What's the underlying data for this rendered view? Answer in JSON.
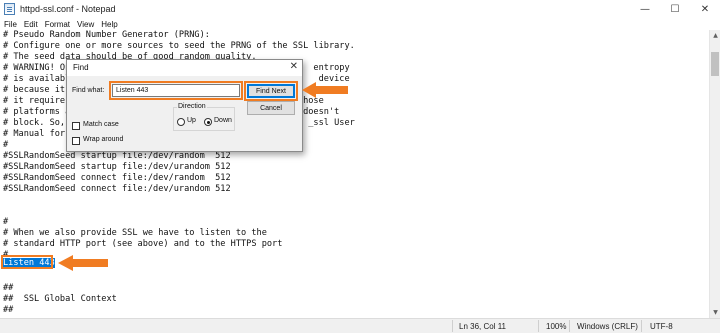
{
  "window": {
    "title": "httpd-ssl.conf - Notepad",
    "controls": {
      "minimize": "—",
      "maximize": "☐",
      "close": "✕"
    }
  },
  "menu": [
    "File",
    "Edit",
    "Format",
    "View",
    "Help"
  ],
  "editor": {
    "lines": [
      "# Pseudo Random Number Generator (PRNG):",
      "# Configure one or more sources to seed the PRNG of the SSL library.",
      "# The seed data should be of good random quality.",
      "# WARNING! On                                               entropy",
      "# is available                                               device",
      "# because it w",
      "# it requires                                             hose",
      "# platforms ac                                            doesn't",
      "# block. So,                                               _ssl User",
      "# Manual for m",
      "#",
      "#SSLRandomSeed startup file:/dev/random  512",
      "#SSLRandomSeed startup file:/dev/urandom 512",
      "#SSLRandomSeed connect file:/dev/random  512",
      "#SSLRandomSeed connect file:/dev/urandom 512",
      "",
      "",
      "#",
      "# When we also provide SSL we have to listen to the",
      "# standard HTTP port (see above) and to the HTTPS port",
      "#",
      "Listen 443",
      "",
      "##",
      "##  SSL Global Context",
      "##"
    ],
    "selected_text": "Listen 443"
  },
  "find_dialog": {
    "title": "Find",
    "find_what_label": "Find what:",
    "find_what_value": "Listen 443",
    "find_next_label": "Find Next",
    "cancel_label": "Cancel",
    "direction_label": "Direction",
    "up_label": "Up",
    "down_label": "Down",
    "direction_selected": "Down",
    "match_case_label": "Match case",
    "wrap_around_label": "Wrap around",
    "close_glyph": "✕"
  },
  "status": {
    "position": "Ln 36, Col 11",
    "zoom": "100%",
    "line_ending": "Windows (CRLF)",
    "encoding": "UTF-8"
  },
  "colors": {
    "annotation_orange": "#f07c22",
    "selection_blue": "#0078d7"
  },
  "icons": {
    "app": "notepad-icon",
    "scroll_up": "chevron-up-icon",
    "scroll_down": "chevron-down-icon"
  }
}
